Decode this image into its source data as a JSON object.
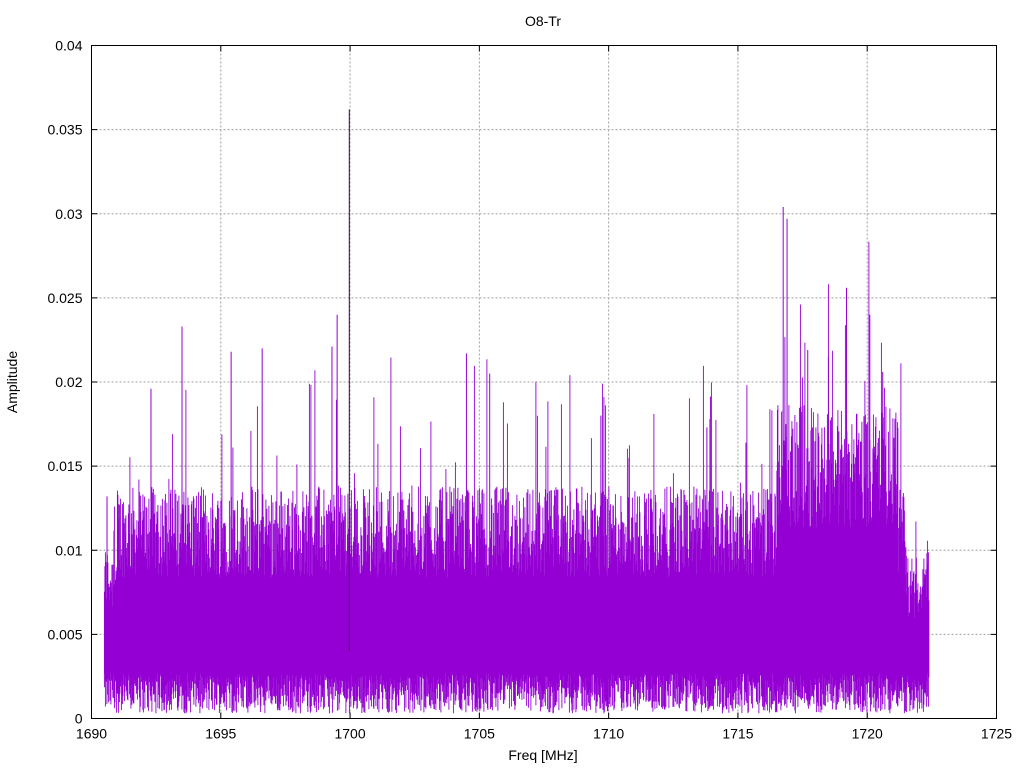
{
  "chart_data": {
    "type": "line",
    "title": "O8-Tr",
    "xlabel": "Freq [MHz]",
    "ylabel": "Amplitude",
    "xlim": [
      1690,
      1725
    ],
    "ylim": [
      0,
      0.04
    ],
    "xticks": [
      "1690",
      "1695",
      "1700",
      "1705",
      "1710",
      "1715",
      "1720",
      "1725"
    ],
    "yticks": [
      "0",
      "0.005",
      "0.01",
      "0.015",
      "0.02",
      "0.025",
      "0.03",
      "0.035",
      "0.04"
    ],
    "grid": true,
    "series_color": "#9400d3",
    "data_x_range": [
      1690.5,
      1722.4
    ],
    "noise_band": {
      "typical_min": 0.002,
      "typical_max": 0.012,
      "floor": 0.0003
    },
    "peaks": [
      {
        "x": 1699.97,
        "y": 0.0362
      },
      {
        "x": 1716.75,
        "y": 0.0304
      },
      {
        "x": 1716.9,
        "y": 0.0297
      },
      {
        "x": 1719.2,
        "y": 0.0256
      },
      {
        "x": 1720.1,
        "y": 0.024
      },
      {
        "x": 1699.5,
        "y": 0.024
      },
      {
        "x": 1693.5,
        "y": 0.0233
      },
      {
        "x": 1699.3,
        "y": 0.0221
      },
      {
        "x": 1696.6,
        "y": 0.022
      },
      {
        "x": 1717.7,
        "y": 0.0219
      },
      {
        "x": 1695.4,
        "y": 0.0218
      },
      {
        "x": 1704.5,
        "y": 0.0217
      },
      {
        "x": 1718.5,
        "y": 0.0215
      },
      {
        "x": 1705.4,
        "y": 0.0205
      },
      {
        "x": 1692.3,
        "y": 0.0196
      },
      {
        "x": 1720.6,
        "y": 0.0206
      },
      {
        "x": 1709.7,
        "y": 0.018
      },
      {
        "x": 1713.8,
        "y": 0.0173
      },
      {
        "x": 1690.6,
        "y": 0.0132
      }
    ]
  }
}
